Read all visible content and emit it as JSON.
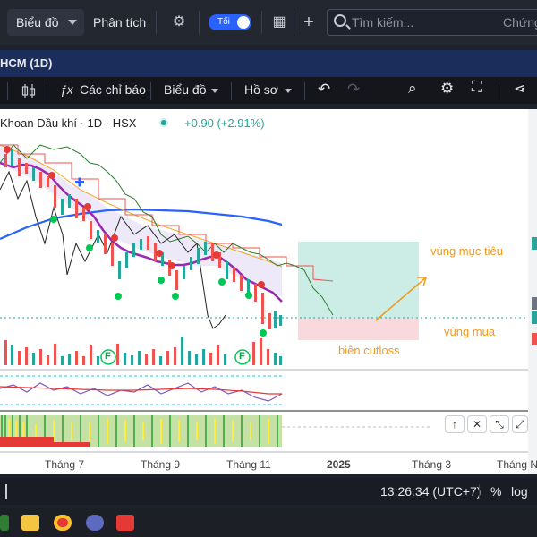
{
  "topbar": {
    "dropdown_label": "Biểu đồ",
    "analysis_label": "Phân tích",
    "toggle_label": "Tối",
    "search_placeholder": "Tìm kiếm...",
    "search_right_text": "Chứng"
  },
  "window": {
    "title": "HCM (1D)"
  },
  "toolbar": {
    "indicators_label": "Các chỉ báo",
    "chart_label": "Biểu đồ",
    "profile_label": "Hồ sơ"
  },
  "legend": {
    "title": "Khoan Dầu khí · 1D · HSX",
    "change": "+0.90 (+2.91%)"
  },
  "annotations": {
    "target": "vùng mục tiêu",
    "buy": "vùng mua",
    "cutloss": "biên cutloss"
  },
  "markers": {
    "f1": "F",
    "f2": "F"
  },
  "x_axis": {
    "labels": [
      "Tháng 7",
      "Tháng 9",
      "Tháng 11",
      "2025",
      "Tháng 3",
      "Tháng Năm"
    ]
  },
  "pane_buttons": [
    "↑",
    "✕",
    "⤡",
    "⤢"
  ],
  "status": {
    "time": "13:26:34 (UTC+7)",
    "percent": "%",
    "log": "log"
  },
  "colors": {
    "accent": "#2962ff",
    "up": "#26a69a",
    "down": "#ef5350",
    "annotation": "#f29a1f"
  }
}
